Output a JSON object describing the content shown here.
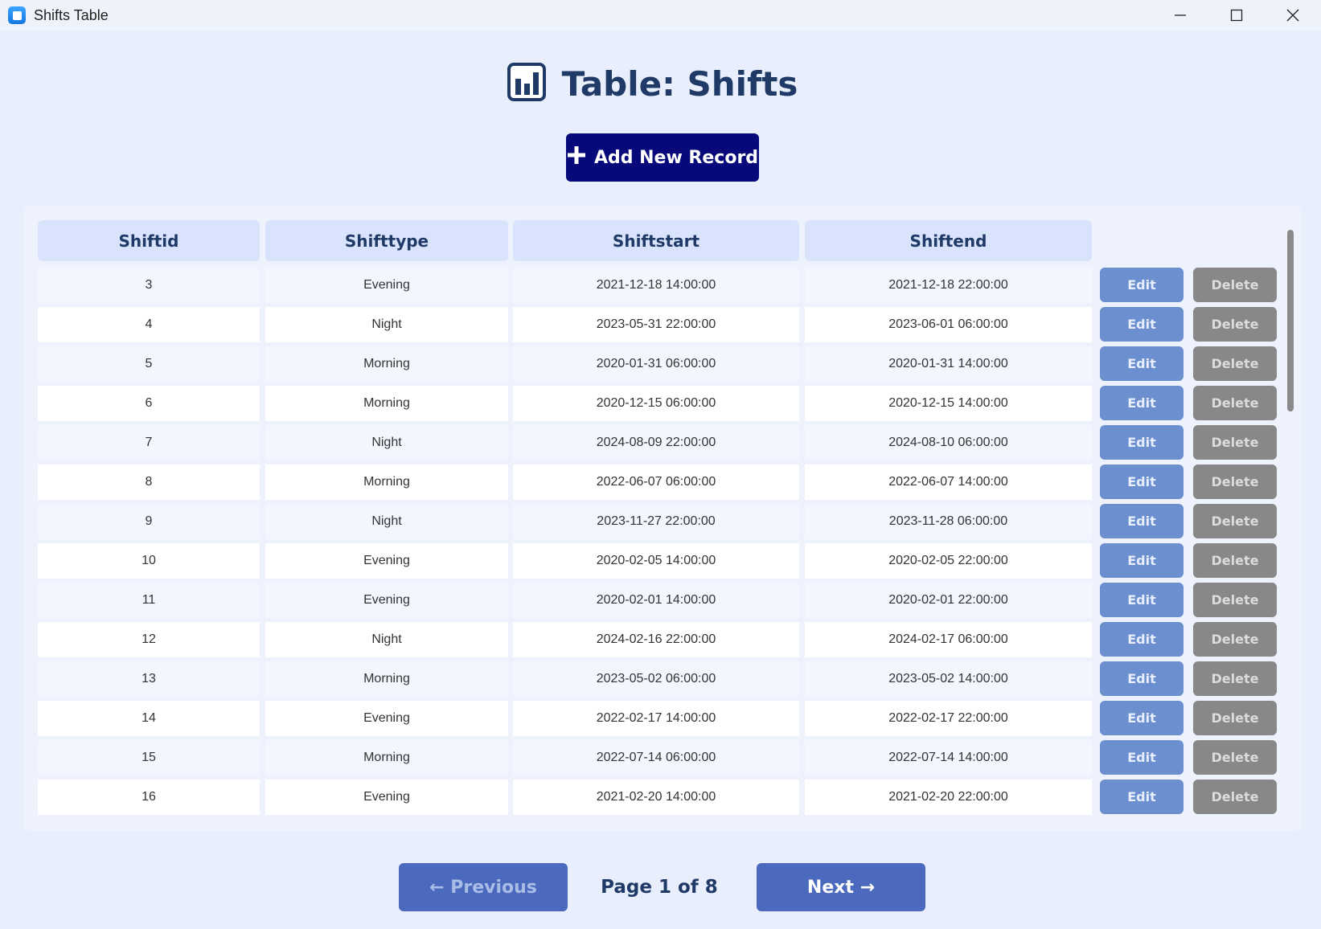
{
  "window": {
    "title": "Shifts Table",
    "controls": [
      "minimize-icon",
      "maximize-icon",
      "close-icon"
    ]
  },
  "header": {
    "title": "Table: Shifts",
    "icon": "bar-chart-icon"
  },
  "toolbar": {
    "add_label": "Add New Record",
    "add_icon": "plus-icon"
  },
  "table": {
    "columns": [
      "Shiftid",
      "Shifttype",
      "Shiftstart",
      "Shiftend"
    ],
    "rows": [
      {
        "id": "3",
        "type": "Evening",
        "start": "2021-12-18 14:00:00",
        "end": "2021-12-18 22:00:00"
      },
      {
        "id": "4",
        "type": "Night",
        "start": "2023-05-31 22:00:00",
        "end": "2023-06-01 06:00:00"
      },
      {
        "id": "5",
        "type": "Morning",
        "start": "2020-01-31 06:00:00",
        "end": "2020-01-31 14:00:00"
      },
      {
        "id": "6",
        "type": "Morning",
        "start": "2020-12-15 06:00:00",
        "end": "2020-12-15 14:00:00"
      },
      {
        "id": "7",
        "type": "Night",
        "start": "2024-08-09 22:00:00",
        "end": "2024-08-10 06:00:00"
      },
      {
        "id": "8",
        "type": "Morning",
        "start": "2022-06-07 06:00:00",
        "end": "2022-06-07 14:00:00"
      },
      {
        "id": "9",
        "type": "Night",
        "start": "2023-11-27 22:00:00",
        "end": "2023-11-28 06:00:00"
      },
      {
        "id": "10",
        "type": "Evening",
        "start": "2020-02-05 14:00:00",
        "end": "2020-02-05 22:00:00"
      },
      {
        "id": "11",
        "type": "Evening",
        "start": "2020-02-01 14:00:00",
        "end": "2020-02-01 22:00:00"
      },
      {
        "id": "12",
        "type": "Night",
        "start": "2024-02-16 22:00:00",
        "end": "2024-02-17 06:00:00"
      },
      {
        "id": "13",
        "type": "Morning",
        "start": "2023-05-02 06:00:00",
        "end": "2023-05-02 14:00:00"
      },
      {
        "id": "14",
        "type": "Evening",
        "start": "2022-02-17 14:00:00",
        "end": "2022-02-17 22:00:00"
      },
      {
        "id": "15",
        "type": "Morning",
        "start": "2022-07-14 06:00:00",
        "end": "2022-07-14 14:00:00"
      },
      {
        "id": "16",
        "type": "Evening",
        "start": "2021-02-20 14:00:00",
        "end": "2021-02-20 22:00:00"
      }
    ],
    "edit_label": "Edit",
    "delete_label": "Delete"
  },
  "pagination": {
    "prev_label": "← Previous",
    "page_label": "Page 1 of 8",
    "next_label": "Next →"
  },
  "colors": {
    "background": "#e8eefb",
    "accent": "#07097a",
    "edit": "#6b8fcf",
    "delete": "#888888",
    "pager": "#4b69bd",
    "heading": "#1f3a66"
  }
}
